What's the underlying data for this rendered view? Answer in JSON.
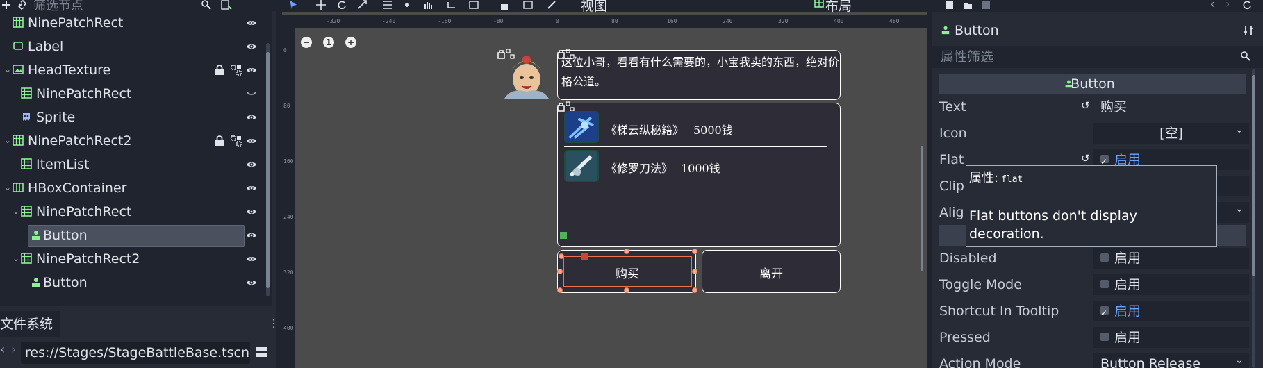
{
  "scene": {
    "filter_placeholder": "筛选节点",
    "nodes": [
      {
        "label": "NinePatchRect",
        "icon": "ninepatch"
      },
      {
        "label": "Label",
        "icon": "label"
      },
      {
        "label": "HeadTexture",
        "icon": "texture",
        "expanded": true,
        "locked": true,
        "grouped": true
      },
      {
        "label": "NinePatchRect",
        "icon": "ninepatch"
      },
      {
        "label": "Sprite",
        "icon": "sprite"
      },
      {
        "label": "NinePatchRect2",
        "icon": "ninepatch",
        "expanded": true,
        "locked": true,
        "grouped": true
      },
      {
        "label": "ItemList",
        "icon": "itemlist"
      },
      {
        "label": "HBoxContainer",
        "icon": "hbox",
        "expanded": true
      },
      {
        "label": "NinePatchRect",
        "icon": "ninepatch",
        "expanded": true
      },
      {
        "label": "Button",
        "icon": "button",
        "selected": true
      },
      {
        "label": "NinePatchRect2",
        "icon": "ninepatch",
        "expanded": true
      },
      {
        "label": "Button",
        "icon": "button"
      }
    ]
  },
  "filesystem": {
    "title": "文件系统",
    "path": "res://Stages/StageBattleBase.tscn"
  },
  "viewport": {
    "toolbar_view": "视图",
    "toolbar_layout": "布局",
    "ruler_ticks_h": [
      "-320",
      "-240",
      "-160",
      "-80",
      "0",
      "80",
      "160",
      "240",
      "320",
      "400",
      "480"
    ],
    "ruler_ticks_v": [
      "0",
      "80",
      "160",
      "240",
      "320",
      "400"
    ],
    "zoom_reset": "1",
    "dialog_text": "这位小哥，看看有什么需要的，小宝我卖的东西，绝对价格公道。",
    "items": [
      {
        "name": "《梯云纵秘籍》",
        "price": "5000钱",
        "icon": "skill-book-icon"
      },
      {
        "name": "《修罗刀法》",
        "price": "1000钱",
        "icon": "blade-technique-icon"
      }
    ],
    "buy_button": "购买",
    "leave_button": "离开"
  },
  "inspector": {
    "node_title": "Button",
    "filter_placeholder": "属性筛选",
    "section": "Button",
    "properties": [
      {
        "name": "Text",
        "value": "购买",
        "kind": "text",
        "revert": true
      },
      {
        "name": "Icon",
        "value": "[空]",
        "kind": "dropdown"
      },
      {
        "name": "Flat",
        "value": "启用",
        "kind": "check",
        "checked": true,
        "revert": true
      },
      {
        "name": "Clip",
        "value": "",
        "kind": "partial"
      },
      {
        "name": "Alig",
        "value": "",
        "kind": "partial"
      },
      {
        "name": "",
        "value": "",
        "kind": "section"
      },
      {
        "name": "Disabled",
        "value": "启用",
        "kind": "check",
        "checked": false
      },
      {
        "name": "Toggle Mode",
        "value": "启用",
        "kind": "check",
        "checked": false
      },
      {
        "name": "Shortcut In Tooltip",
        "value": "启用",
        "kind": "check",
        "checked": true
      },
      {
        "name": "Pressed",
        "value": "启用",
        "kind": "check",
        "checked": false
      },
      {
        "name": "Action Mode",
        "value": "Button Release",
        "kind": "dropdown"
      }
    ],
    "tooltip": {
      "prefix": "属性:",
      "code": "flat",
      "body": "Flat buttons don't display decoration."
    }
  },
  "colors": {
    "accent": "#6aa3ff",
    "panel_bg": "#262b36",
    "dark_bg": "#20242e",
    "viewport_bg": "#4b4b4b",
    "selection_orange": "#e8734a",
    "node_green": "#8eef97"
  }
}
